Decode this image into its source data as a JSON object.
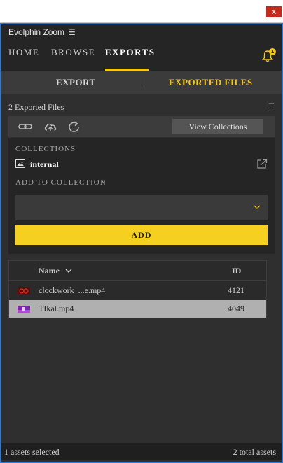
{
  "window": {
    "close_label": "x"
  },
  "header": {
    "brand": "Evolphin Zoom",
    "menu_icon": "hamburger-icon",
    "nav": [
      {
        "label": "HOME",
        "active": false
      },
      {
        "label": "BROWSE",
        "active": false
      },
      {
        "label": "EXPORTS",
        "active": true
      }
    ],
    "notification_count": "1"
  },
  "subtabs": [
    {
      "label": "EXPORT",
      "active": false
    },
    {
      "label": "EXPORTED FILES",
      "active": true
    }
  ],
  "files": {
    "count_label": "2 Exported Files"
  },
  "toolbar": {
    "icons": [
      "link-icon",
      "cloud-upload-icon",
      "refresh-icon"
    ],
    "view_collections_label": "View Collections"
  },
  "collections": {
    "heading": "COLLECTIONS",
    "items": [
      {
        "name": "internal"
      }
    ],
    "add_heading": "ADD TO COLLECTION",
    "dropdown_value": "",
    "add_label": "ADD"
  },
  "table": {
    "columns": [
      "Name",
      "ID"
    ],
    "rows": [
      {
        "name": "clockwork_...e.mp4",
        "id": "4121",
        "selected": false
      },
      {
        "name": "TIkal.mp4",
        "id": "4049",
        "selected": true
      }
    ]
  },
  "footer": {
    "selected": "1 assets selected",
    "total": "2 total assets"
  },
  "colors": {
    "accent": "#f5c61a",
    "add_button": "#f5d020",
    "frame_border": "#3a77c2",
    "close": "#c42b1c"
  }
}
